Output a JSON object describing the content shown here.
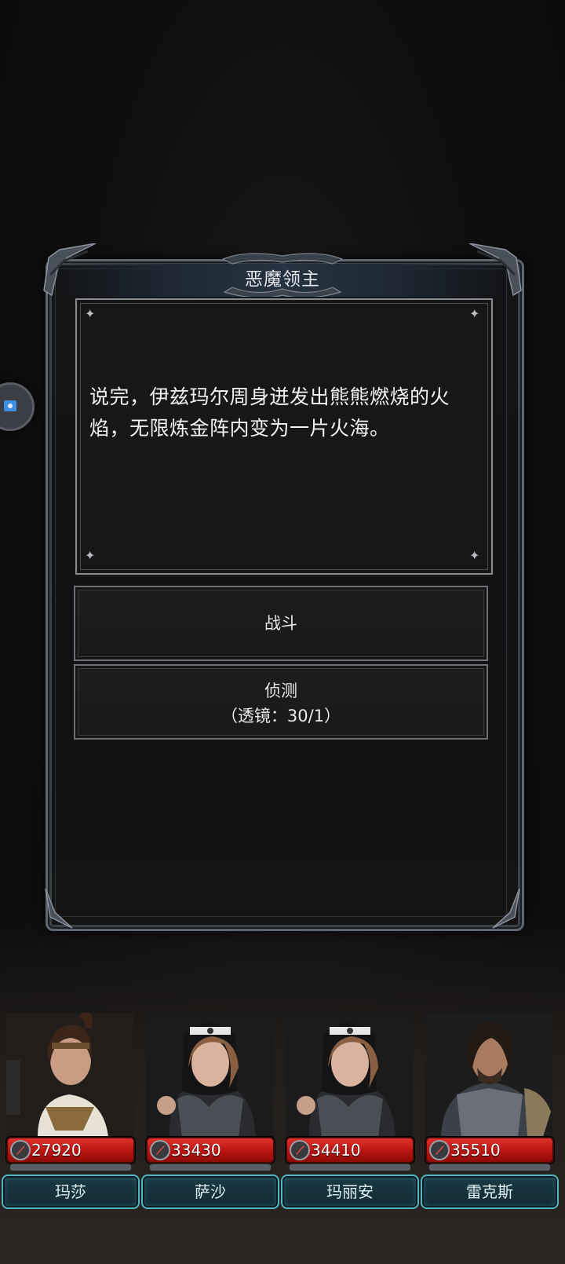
{
  "dialog": {
    "title": "恶魔领主",
    "story": "说完，伊兹玛尔周身迸发出熊熊燃烧的火焰，无限炼金阵内变为一片火海。",
    "options": {
      "fight": "战斗",
      "detect": "侦测",
      "detect_cost": "（透镜：30/1）"
    }
  },
  "party": [
    {
      "name": "玛莎",
      "power": "27920"
    },
    {
      "name": "萨沙",
      "power": "33430"
    },
    {
      "name": "玛丽安",
      "power": "34410"
    },
    {
      "name": "雷克斯",
      "power": "35510"
    }
  ],
  "colors": {
    "hp_bar": "#c4201b",
    "name_bar_border": "#4fb7c3",
    "frame": "#5e6670"
  },
  "icons": {
    "float_button": "photo-icon",
    "power": "sword-icon"
  }
}
